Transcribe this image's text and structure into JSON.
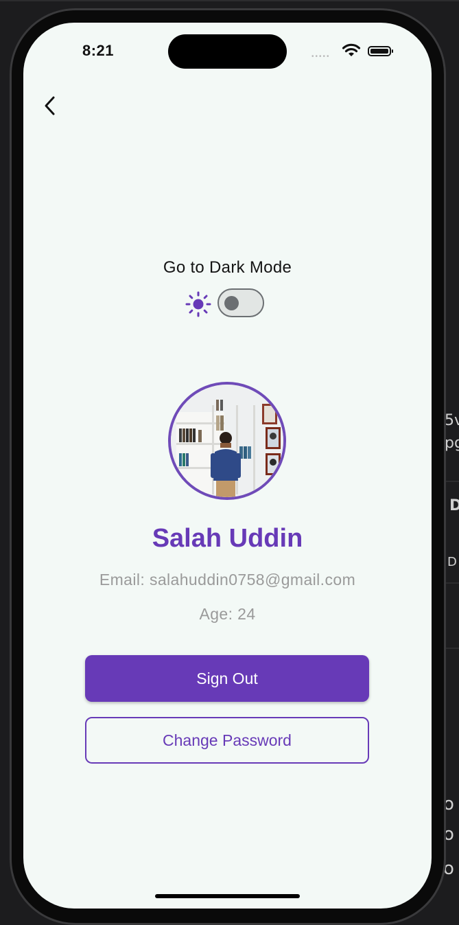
{
  "status_bar": {
    "time": "8:21",
    "signal_icon": "cellular-dots-icon",
    "wifi_icon": "wifi-icon",
    "battery_icon": "battery-full-icon"
  },
  "nav": {
    "back_icon": "chevron-left-icon"
  },
  "theme_toggle": {
    "label": "Go to Dark Mode",
    "icon": "sun-icon",
    "is_dark": false,
    "accent": "#673ab7"
  },
  "profile": {
    "name": "Salah Uddin",
    "email": "Email: salahuddin0758@gmail.com",
    "age": "Age: 24",
    "avatar": "profile-photo"
  },
  "actions": {
    "sign_out": "Sign Out",
    "change_password": "Change Password"
  },
  "background_fragments": [
    "5v",
    "pg",
    "D",
    "D",
    "o",
    "o",
    "o"
  ],
  "colors": {
    "primary": "#673ab7",
    "screen_bg": "#f3f9f6",
    "muted_text": "#9a9a9a"
  }
}
